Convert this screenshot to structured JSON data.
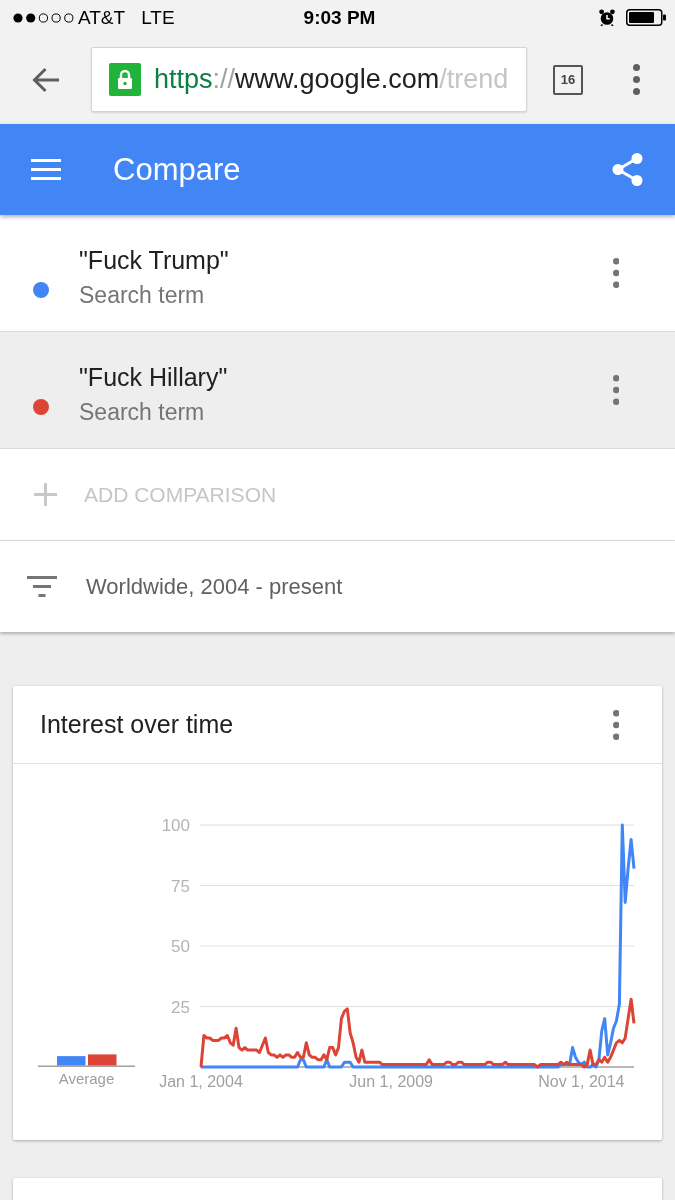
{
  "status_bar": {
    "carrier": "AT&T",
    "network": "LTE",
    "time": "9:03 PM"
  },
  "browser": {
    "url": {
      "scheme": "https",
      "separator": "://",
      "host": "www.google.com",
      "path": "/trend"
    },
    "tab_count": "16"
  },
  "app_bar": {
    "title": "Compare"
  },
  "terms": [
    {
      "label": "\"Fuck Trump\"",
      "sublabel": "Search term",
      "color": "#4285f4",
      "selected": false
    },
    {
      "label": "\"Fuck Hillary\"",
      "sublabel": "Search term",
      "color": "#db4437",
      "selected": true
    }
  ],
  "add_comparison": {
    "label": "ADD COMPARISON",
    "disabled": true
  },
  "filter": {
    "label": "Worldwide, 2004 - present"
  },
  "interest_card": {
    "title": "Interest over time",
    "average_label": "Average",
    "chart_data": {
      "type": "line",
      "grid": true,
      "categories": [
        "Jan 1, 2004",
        null,
        null,
        null,
        null,
        null,
        null,
        null,
        null,
        null,
        null,
        null,
        null,
        null,
        null,
        null,
        null,
        null,
        null,
        null,
        null,
        null,
        null,
        null,
        null,
        null,
        null,
        null,
        null,
        null,
        null,
        null,
        null,
        null,
        null,
        null,
        null,
        null,
        null,
        null,
        null,
        null,
        null,
        null,
        null,
        null,
        null,
        null,
        null,
        null,
        null,
        null,
        null,
        null,
        null,
        null,
        null,
        null,
        null,
        null,
        null,
        null,
        null,
        null,
        null,
        "Jun 1, 2009",
        null,
        null,
        null,
        null,
        null,
        null,
        null,
        null,
        null,
        null,
        null,
        null,
        null,
        null,
        null,
        null,
        null,
        null,
        null,
        null,
        null,
        null,
        null,
        null,
        null,
        null,
        null,
        null,
        null,
        null,
        null,
        null,
        null,
        null,
        null,
        null,
        null,
        null,
        null,
        null,
        null,
        null,
        null,
        null,
        null,
        null,
        null,
        null,
        null,
        null,
        null,
        null,
        null,
        null,
        null,
        null,
        null,
        null,
        null,
        null,
        null,
        null,
        null,
        null,
        "Nov 1, 2014",
        null,
        null,
        null,
        null,
        null,
        null,
        null,
        null,
        null,
        null,
        null,
        null,
        null,
        null,
        null,
        null,
        null,
        null
      ],
      "ylim": [
        0,
        100
      ],
      "yticks": [
        25,
        50,
        75,
        100
      ],
      "series": [
        {
          "color": "#4285f4",
          "values": [
            0,
            0,
            0,
            0,
            0,
            0,
            0,
            0,
            0,
            0,
            0,
            0,
            0,
            0,
            0,
            0,
            0,
            0,
            0,
            0,
            0,
            0,
            0,
            0,
            0,
            0,
            0,
            0,
            0,
            0,
            0,
            0,
            0,
            0,
            3,
            3,
            0,
            0,
            0,
            0,
            0,
            0,
            0,
            3,
            0,
            0,
            0,
            0,
            0,
            2,
            2,
            2,
            0,
            0,
            0,
            0,
            0,
            0,
            0,
            0,
            0,
            0,
            0,
            0,
            0,
            0,
            0,
            0,
            0,
            0,
            0,
            0,
            0,
            0,
            0,
            0,
            0,
            0,
            0,
            0,
            0,
            0,
            0,
            0,
            0,
            0,
            0,
            0,
            0,
            0,
            0,
            0,
            0,
            0,
            0,
            0,
            0,
            0,
            0,
            0,
            0,
            0,
            0,
            0,
            0,
            0,
            0,
            0,
            0,
            0,
            0,
            0,
            0,
            0,
            0,
            0,
            0,
            0,
            0,
            0,
            0,
            0,
            0,
            1,
            1,
            1,
            1,
            8,
            4,
            2,
            1,
            2,
            0,
            0,
            1,
            0,
            3,
            15,
            20,
            5,
            10,
            16,
            19,
            26,
            100,
            68,
            82,
            94,
            82
          ]
        },
        {
          "color": "#db4437",
          "values": [
            0,
            13,
            12,
            12,
            11,
            11,
            11,
            12,
            12,
            13,
            10,
            9,
            16,
            8,
            7,
            8,
            7,
            7,
            7,
            7,
            6,
            9,
            12,
            6,
            5,
            5,
            4,
            5,
            4,
            5,
            5,
            4,
            4,
            6,
            4,
            4,
            10,
            5,
            4,
            4,
            3,
            3,
            5,
            3,
            8,
            8,
            5,
            8,
            20,
            23,
            24,
            14,
            10,
            4,
            2,
            7,
            2,
            2,
            2,
            2,
            2,
            2,
            1,
            1,
            1,
            1,
            1,
            1,
            1,
            1,
            1,
            1,
            1,
            1,
            1,
            1,
            1,
            1,
            3,
            1,
            1,
            1,
            1,
            1,
            2,
            2,
            1,
            1,
            2,
            2,
            1,
            1,
            1,
            1,
            1,
            1,
            1,
            1,
            2,
            2,
            1,
            1,
            1,
            1,
            2,
            1,
            1,
            1,
            1,
            1,
            1,
            1,
            1,
            1,
            1,
            0,
            1,
            1,
            1,
            1,
            1,
            1,
            1,
            2,
            1,
            2,
            1,
            1,
            1,
            1,
            1,
            0,
            1,
            7,
            1,
            1,
            3,
            2,
            4,
            2,
            4,
            7,
            10,
            11,
            10,
            12,
            20,
            28,
            18
          ]
        }
      ]
    }
  }
}
